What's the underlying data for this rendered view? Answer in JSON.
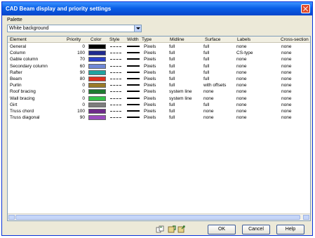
{
  "window": {
    "title": "CAD Beam display and priority settings"
  },
  "palette": {
    "label": "Palette",
    "value": "White background"
  },
  "columns": [
    "Element",
    "Priority",
    "Color",
    "Style",
    "Width",
    "Type",
    "Midline",
    "Surface",
    "Labels",
    "Cross-section"
  ],
  "rows": [
    {
      "element": "General",
      "priority": "0",
      "color": "#000000",
      "style": "dashed",
      "type": "Pixels",
      "midline": "full",
      "surface": "full",
      "labels": "none",
      "cross": "none"
    },
    {
      "element": "Column",
      "priority": "100",
      "color": "#1f2a8f",
      "style": "dashed",
      "type": "Pixels",
      "midline": "full",
      "surface": "full",
      "labels": "CS-type",
      "cross": "none"
    },
    {
      "element": "Gable column",
      "priority": "70",
      "color": "#2b40c8",
      "style": "dashed",
      "type": "Pixels",
      "midline": "full",
      "surface": "full",
      "labels": "none",
      "cross": "none"
    },
    {
      "element": "Secondary column",
      "priority": "60",
      "color": "#6f88d6",
      "style": "dashdot",
      "type": "Pixels",
      "midline": "full",
      "surface": "full",
      "labels": "none",
      "cross": "none"
    },
    {
      "element": "Rafter",
      "priority": "90",
      "color": "#21a3a0",
      "style": "dashed",
      "type": "Pixels",
      "midline": "full",
      "surface": "full",
      "labels": "none",
      "cross": "none"
    },
    {
      "element": "Beam",
      "priority": "80",
      "color": "#e0301e",
      "style": "dashed",
      "type": "Pixels",
      "midline": "full",
      "surface": "full",
      "labels": "none",
      "cross": "none"
    },
    {
      "element": "Purlin",
      "priority": "0",
      "color": "#9a7a28",
      "style": "dashed",
      "type": "Pixels",
      "midline": "full",
      "surface": "with offsets",
      "labels": "none",
      "cross": "none"
    },
    {
      "element": "Roof bracing",
      "priority": "0",
      "color": "#1e7a30",
      "style": "dashed",
      "type": "Pixels",
      "midline": "system line",
      "surface": "none",
      "labels": "none",
      "cross": "none"
    },
    {
      "element": "Wall bracing",
      "priority": "0",
      "color": "#35c24a",
      "style": "dashed",
      "type": "Pixels",
      "midline": "system line",
      "surface": "none",
      "labels": "none",
      "cross": "none"
    },
    {
      "element": "Girt",
      "priority": "0",
      "color": "#7d7d7d",
      "style": "dashdot",
      "type": "Pixels",
      "midline": "full",
      "surface": "full",
      "labels": "none",
      "cross": "none"
    },
    {
      "element": "Truss chord",
      "priority": "100",
      "color": "#6e2a8a",
      "style": "dashed",
      "type": "Pixels",
      "midline": "full",
      "surface": "none",
      "labels": "none",
      "cross": "none"
    },
    {
      "element": "Truss diagonal",
      "priority": "90",
      "color": "#9a4bbf",
      "style": "dashed",
      "type": "Pixels",
      "midline": "full",
      "surface": "none",
      "labels": "none",
      "cross": "none"
    }
  ],
  "buttons": {
    "ok": "OK",
    "cancel": "Cancel",
    "help": "Help"
  },
  "icons": {
    "copy": "copy-icon",
    "save": "save-icon",
    "load": "load-icon"
  }
}
